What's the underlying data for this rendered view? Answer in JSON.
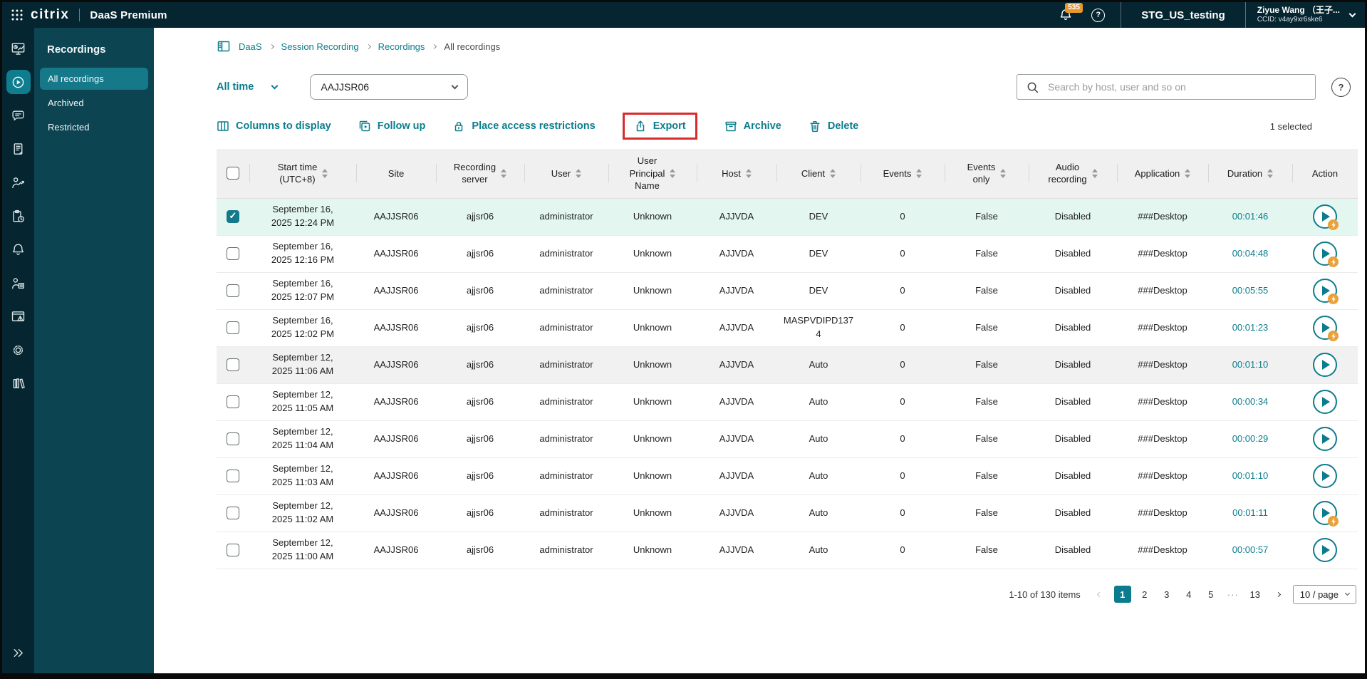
{
  "topbar": {
    "logo": "citrix",
    "product": "DaaS Premium",
    "notifications_badge": "535",
    "org": "STG_US_testing",
    "user_name": "Ziyue Wang （王子...",
    "user_ccid": "CCID: v4ay9xr6ske6"
  },
  "sidebar": {
    "title": "Recordings",
    "items": [
      {
        "label": "All recordings",
        "active": true
      },
      {
        "label": "Archived",
        "active": false
      },
      {
        "label": "Restricted",
        "active": false
      }
    ]
  },
  "breadcrumb": {
    "items": [
      "DaaS",
      "Session Recording",
      "Recordings",
      "All recordings"
    ]
  },
  "filters": {
    "time_range": "All time",
    "server_filter": "AAJJSR06"
  },
  "search": {
    "placeholder": "Search by host, user and so on"
  },
  "toolbar": {
    "buttons": [
      {
        "label": "Columns to display"
      },
      {
        "label": "Follow up"
      },
      {
        "label": "Place access restrictions"
      },
      {
        "label": "Export",
        "highlighted": true
      },
      {
        "label": "Archive"
      },
      {
        "label": "Delete"
      }
    ],
    "selected_count": "1 selected"
  },
  "table": {
    "columns": [
      {
        "key": "checkbox",
        "label": "",
        "sortable": false
      },
      {
        "key": "start_time",
        "label": "Start time\n(UTC+8)",
        "sortable": true
      },
      {
        "key": "site",
        "label": "Site",
        "sortable": false
      },
      {
        "key": "recording_server",
        "label": "Recording\nserver",
        "sortable": true
      },
      {
        "key": "user",
        "label": "User",
        "sortable": true
      },
      {
        "key": "upn",
        "label": "User\nPrincipal\nName",
        "sortable": true
      },
      {
        "key": "host",
        "label": "Host",
        "sortable": true
      },
      {
        "key": "client",
        "label": "Client",
        "sortable": true
      },
      {
        "key": "events",
        "label": "Events",
        "sortable": true
      },
      {
        "key": "events_only",
        "label": "Events\nonly",
        "sortable": true
      },
      {
        "key": "audio_recording",
        "label": "Audio\nrecording",
        "sortable": true
      },
      {
        "key": "application",
        "label": "Application",
        "sortable": true
      },
      {
        "key": "duration",
        "label": "Duration",
        "sortable": true
      },
      {
        "key": "action",
        "label": "Action",
        "sortable": false
      }
    ],
    "rows": [
      {
        "checked": true,
        "selected": true,
        "highlighted": false,
        "start_time": "September 16,\n2025 12:24 PM",
        "site": "AAJJSR06",
        "recording_server": "ajjsr06",
        "user": "administrator",
        "upn": "Unknown",
        "host": "AJJVDA",
        "client": "DEV",
        "events": "0",
        "events_only": "False",
        "audio_recording": "Disabled",
        "application": "###Desktop",
        "duration": "00:01:46",
        "live_badge": true
      },
      {
        "checked": false,
        "selected": false,
        "highlighted": false,
        "start_time": "September 16,\n2025 12:16 PM",
        "site": "AAJJSR06",
        "recording_server": "ajjsr06",
        "user": "administrator",
        "upn": "Unknown",
        "host": "AJJVDA",
        "client": "DEV",
        "events": "0",
        "events_only": "False",
        "audio_recording": "Disabled",
        "application": "###Desktop",
        "duration": "00:04:48",
        "live_badge": true
      },
      {
        "checked": false,
        "selected": false,
        "highlighted": false,
        "start_time": "September 16,\n2025 12:07 PM",
        "site": "AAJJSR06",
        "recording_server": "ajjsr06",
        "user": "administrator",
        "upn": "Unknown",
        "host": "AJJVDA",
        "client": "DEV",
        "events": "0",
        "events_only": "False",
        "audio_recording": "Disabled",
        "application": "###Desktop",
        "duration": "00:05:55",
        "live_badge": true
      },
      {
        "checked": false,
        "selected": false,
        "highlighted": false,
        "start_time": "September 16,\n2025 12:02 PM",
        "site": "AAJJSR06",
        "recording_server": "ajjsr06",
        "user": "administrator",
        "upn": "Unknown",
        "host": "AJJVDA",
        "client": "MASPVDIPD1374",
        "events": "0",
        "events_only": "False",
        "audio_recording": "Disabled",
        "application": "###Desktop",
        "duration": "00:01:23",
        "live_badge": true
      },
      {
        "checked": false,
        "selected": false,
        "highlighted": true,
        "start_time": "September 12,\n2025 11:06 AM",
        "site": "AAJJSR06",
        "recording_server": "ajjsr06",
        "user": "administrator",
        "upn": "Unknown",
        "host": "AJJVDA",
        "client": "Auto",
        "events": "0",
        "events_only": "False",
        "audio_recording": "Disabled",
        "application": "###Desktop",
        "duration": "00:01:10",
        "live_badge": false
      },
      {
        "checked": false,
        "selected": false,
        "highlighted": false,
        "start_time": "September 12,\n2025 11:05 AM",
        "site": "AAJJSR06",
        "recording_server": "ajjsr06",
        "user": "administrator",
        "upn": "Unknown",
        "host": "AJJVDA",
        "client": "Auto",
        "events": "0",
        "events_only": "False",
        "audio_recording": "Disabled",
        "application": "###Desktop",
        "duration": "00:00:34",
        "live_badge": false
      },
      {
        "checked": false,
        "selected": false,
        "highlighted": false,
        "start_time": "September 12,\n2025 11:04 AM",
        "site": "AAJJSR06",
        "recording_server": "ajjsr06",
        "user": "administrator",
        "upn": "Unknown",
        "host": "AJJVDA",
        "client": "Auto",
        "events": "0",
        "events_only": "False",
        "audio_recording": "Disabled",
        "application": "###Desktop",
        "duration": "00:00:29",
        "live_badge": false
      },
      {
        "checked": false,
        "selected": false,
        "highlighted": false,
        "start_time": "September 12,\n2025 11:03 AM",
        "site": "AAJJSR06",
        "recording_server": "ajjsr06",
        "user": "administrator",
        "upn": "Unknown",
        "host": "AJJVDA",
        "client": "Auto",
        "events": "0",
        "events_only": "False",
        "audio_recording": "Disabled",
        "application": "###Desktop",
        "duration": "00:01:10",
        "live_badge": false
      },
      {
        "checked": false,
        "selected": false,
        "highlighted": false,
        "start_time": "September 12,\n2025 11:02 AM",
        "site": "AAJJSR06",
        "recording_server": "ajjsr06",
        "user": "administrator",
        "upn": "Unknown",
        "host": "AJJVDA",
        "client": "Auto",
        "events": "0",
        "events_only": "False",
        "audio_recording": "Disabled",
        "application": "###Desktop",
        "duration": "00:01:11",
        "live_badge": true
      },
      {
        "checked": false,
        "selected": false,
        "highlighted": false,
        "start_time": "September 12,\n2025 11:00 AM",
        "site": "AAJJSR06",
        "recording_server": "ajjsr06",
        "user": "administrator",
        "upn": "Unknown",
        "host": "AJJVDA",
        "client": "Auto",
        "events": "0",
        "events_only": "False",
        "audio_recording": "Disabled",
        "application": "###Desktop",
        "duration": "00:00:57",
        "live_badge": false
      }
    ]
  },
  "pagination": {
    "summary": "1-10 of 130 items",
    "pages": [
      "1",
      "2",
      "3",
      "4",
      "5",
      "···",
      "13"
    ],
    "current_page": "1",
    "page_size_label": "10 / page"
  },
  "colors": {
    "topbar": "#052530",
    "sidebar": "#0C4452",
    "accent_teal": "#0A7D8C",
    "selected_row": "#E3F6F0",
    "badge_orange": "#E8992C",
    "export_highlight": "#D92B2B"
  }
}
